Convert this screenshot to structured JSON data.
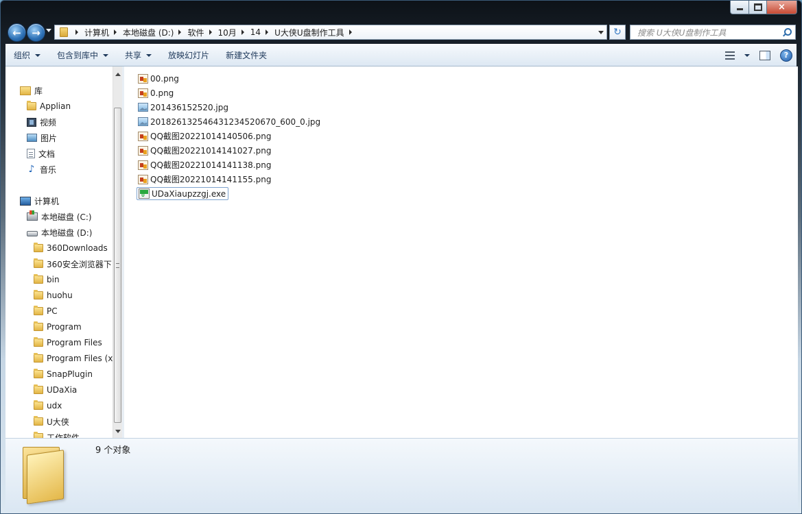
{
  "window": {
    "controls": {
      "minimize": "minimize-icon",
      "maximize": "maximize-icon",
      "close": "×"
    }
  },
  "address": {
    "breadcrumbs": [
      "计算机",
      "本地磁盘 (D:)",
      "软件",
      "10月",
      "14",
      "U大侠U盘制作工具"
    ],
    "refresh_glyph": "↻"
  },
  "search": {
    "placeholder": "搜索 U大侠U盘制作工具"
  },
  "toolbar": {
    "organize": "组织",
    "include_in_library": "包含到库中",
    "share": "共享",
    "slideshow": "放映幻灯片",
    "new_folder": "新建文件夹",
    "help": "?"
  },
  "nav": {
    "library": "库",
    "library_items": [
      "Applian",
      "视频",
      "图片",
      "文档",
      "音乐"
    ],
    "computer": "计算机",
    "drives": [
      "本地磁盘 (C:)",
      "本地磁盘 (D:)"
    ],
    "folders": [
      "360Downloads",
      "360安全浏览器下",
      "bin",
      "huohu",
      "PC",
      "Program",
      "Program Files",
      "Program Files (x",
      "SnapPlugin",
      "UDaXia",
      "udx",
      "U大侠",
      "工作软件"
    ]
  },
  "files": [
    {
      "name": "00.png",
      "type": "png"
    },
    {
      "name": "0.png",
      "type": "png"
    },
    {
      "name": "201436152520.jpg",
      "type": "jpg"
    },
    {
      "name": "20182613254643123452067​0_600_0.jpg",
      "type": "jpg"
    },
    {
      "name": "QQ截图20221014140506.png",
      "type": "png"
    },
    {
      "name": "QQ截图20221014141027.png",
      "type": "png"
    },
    {
      "name": "QQ截图20221014141138.png",
      "type": "png"
    },
    {
      "name": "QQ截图20221014141155.png",
      "type": "png"
    },
    {
      "name": "UDaXiaupzzgj.exe",
      "type": "exe",
      "selected": true
    }
  ],
  "status": {
    "count": "9 个对象"
  }
}
